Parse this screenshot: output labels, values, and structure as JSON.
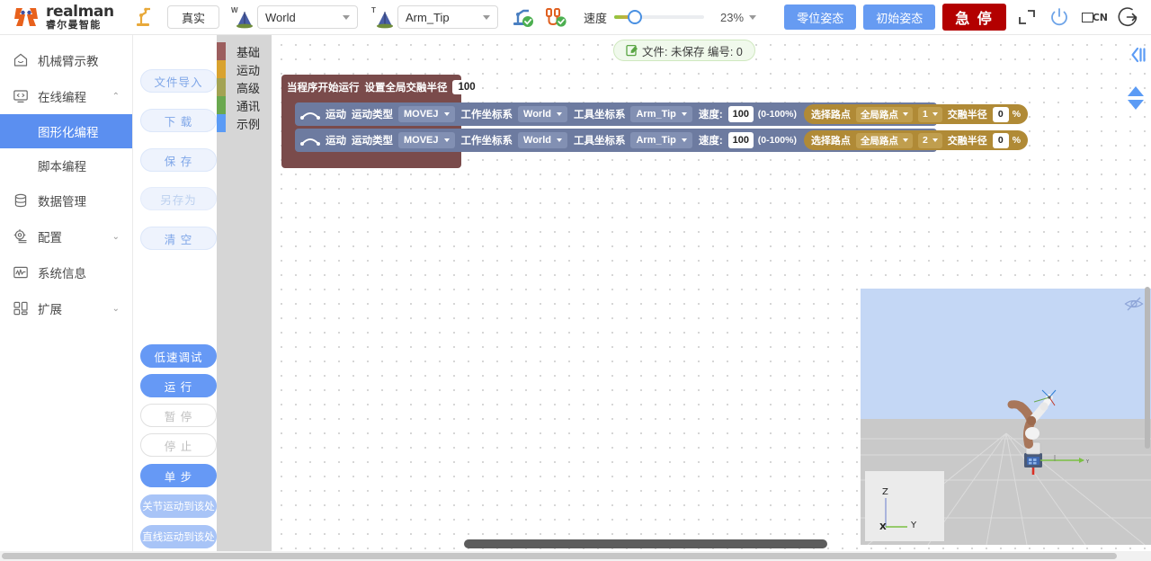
{
  "topbar": {
    "brand_en": "realman",
    "brand_cn": "睿尔曼智能",
    "teach_icon": "robot-teach-icon",
    "mode_button": "真实",
    "world_frame_sup": "W",
    "world_frame_value": "World",
    "tool_frame_sup": "T",
    "tool_frame_value": "Arm_Tip",
    "robot_status_icon": "robot-connected-icon",
    "cable_status_icon": "cable-connected-icon",
    "speed_label": "速度",
    "speed_percent": "23%",
    "speed_fill_pct": 23,
    "zero_pose_button": "零位姿态",
    "init_pose_button": "初始姿态",
    "estop_button": "急 停",
    "fullscreen_icon": "fullscreen-icon",
    "power_icon": "power-icon",
    "lang_label": "CN",
    "logout_icon": "logout-icon",
    "accent_blue": "#669bf2",
    "accent_red": "#b30000"
  },
  "sidebar": {
    "items": [
      {
        "label": "机械臂示教",
        "icon": "home-icon",
        "arrow": "",
        "type": "item"
      },
      {
        "label": "在线编程",
        "icon": "monitor-code-icon",
        "arrow": "⌃",
        "type": "item"
      },
      {
        "label": "图形化编程",
        "icon": "",
        "arrow": "",
        "type": "sub",
        "active": true
      },
      {
        "label": "脚本编程",
        "icon": "",
        "arrow": "",
        "type": "sub",
        "active": false
      },
      {
        "label": "数据管理",
        "icon": "database-icon",
        "arrow": "",
        "type": "item"
      },
      {
        "label": "配置",
        "icon": "gear-icon",
        "arrow": "⌄",
        "type": "item"
      },
      {
        "label": "系统信息",
        "icon": "chart-monitor-icon",
        "arrow": "",
        "type": "item"
      },
      {
        "label": "扩展",
        "icon": "grid-blocks-icon",
        "arrow": "⌄",
        "type": "item"
      }
    ]
  },
  "actions": {
    "file_buttons": [
      {
        "label": "文件导入",
        "style": "ghost"
      },
      {
        "label": "下 载",
        "style": "ghost"
      },
      {
        "label": "保 存",
        "style": "ghost"
      },
      {
        "label": "另存为",
        "style": "ghost-dim"
      },
      {
        "label": "清 空",
        "style": "ghost"
      }
    ],
    "run_buttons": [
      {
        "label": "低速调试",
        "style": "solid"
      },
      {
        "label": "运 行",
        "style": "solid"
      },
      {
        "label": "暂 停",
        "style": "outline-dim"
      },
      {
        "label": "停 止",
        "style": "outline-dim"
      },
      {
        "label": "单 步",
        "style": "solid"
      },
      {
        "label": "关节运动到该处",
        "style": "solid-lite"
      },
      {
        "label": "直线运动到该处",
        "style": "solid-lite"
      }
    ]
  },
  "categories": [
    {
      "label": "基础",
      "color": "#9c5e5e"
    },
    {
      "label": "运动",
      "color": "#d9a22e"
    },
    {
      "label": "高级",
      "color": "#a3a353"
    },
    {
      "label": "通讯",
      "color": "#6aa84f"
    },
    {
      "label": "示例",
      "color": "#5b9bf5"
    }
  ],
  "canvas": {
    "file_chip": {
      "icon": "edit-file-icon",
      "text": "文件: 未保存 编号: 0"
    },
    "program": {
      "hat": {
        "text_left": "当程序开始运行",
        "text_mid": "设置全局交融半径",
        "value": "100",
        "unit": "%"
      },
      "rows": [
        {
          "motion_icon": "arc-motion-icon",
          "motion_label": "运动",
          "type_label": "运动类型",
          "type_value": "MOVEJ",
          "work_frame_label": "工作坐标系",
          "work_frame_value": "World",
          "tool_frame_label": "工具坐标系",
          "tool_frame_value": "Arm_Tip",
          "speed_label": "速度:",
          "speed_value": "100",
          "speed_hint": "(0-100%)",
          "waypoint_label": "选择路点",
          "waypoint_scope": "全局路点",
          "waypoint_index": "1",
          "blend_label": "交融半径",
          "blend_value": "0",
          "blend_unit": "%"
        },
        {
          "motion_icon": "arc-motion-icon",
          "motion_label": "运动",
          "type_label": "运动类型",
          "type_value": "MOVEJ",
          "work_frame_label": "工作坐标系",
          "work_frame_value": "World",
          "tool_frame_label": "工具坐标系",
          "tool_frame_value": "Arm_Tip",
          "speed_label": "速度:",
          "speed_value": "100",
          "speed_hint": "(0-100%)",
          "waypoint_label": "选择路点",
          "waypoint_scope": "全局路点",
          "waypoint_index": "2",
          "blend_label": "交融半径",
          "blend_value": "0",
          "blend_unit": "%"
        }
      ]
    },
    "viewport": {
      "eye_icon": "eye-hidden-icon",
      "axis_z": "Z",
      "axis_y": "Y",
      "axis_x": "X"
    },
    "rail": {
      "collapse_icon": "collapse-panel-icon",
      "up_icon": "arrow-up-icon",
      "down_icon": "arrow-down-icon"
    }
  }
}
